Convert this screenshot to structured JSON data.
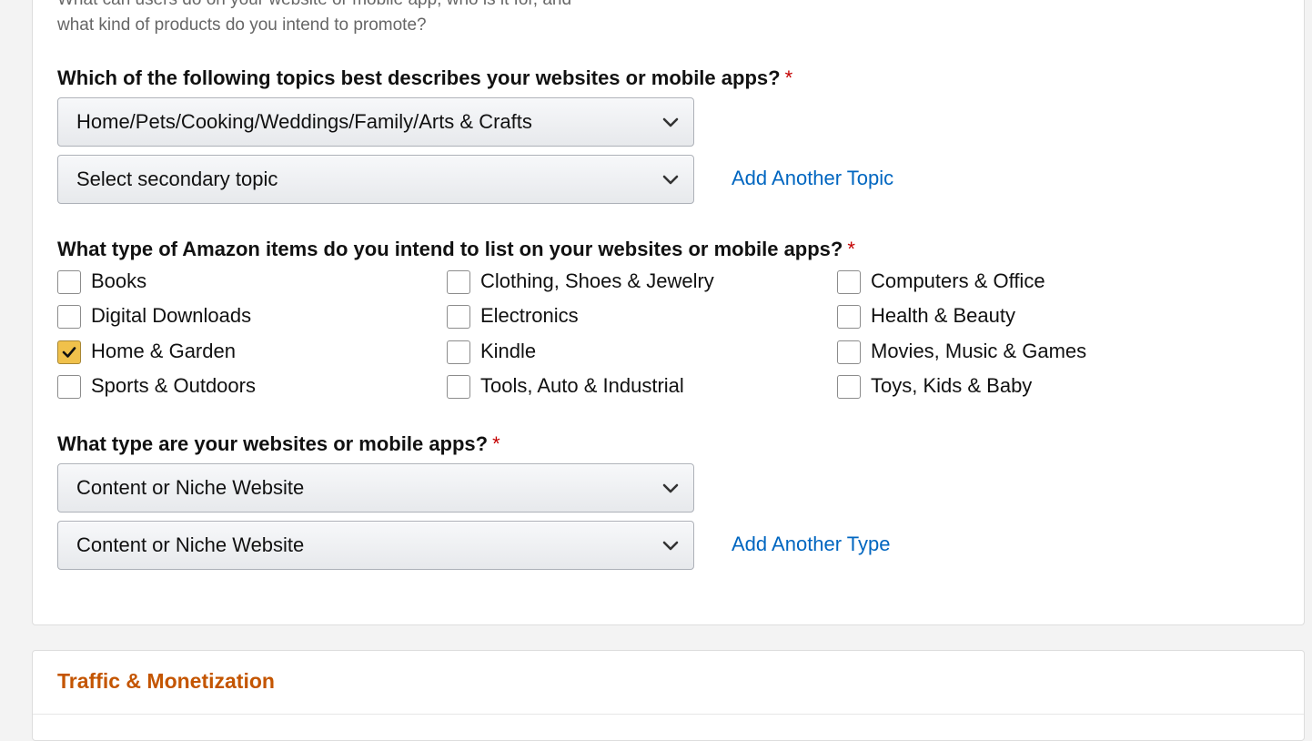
{
  "profile": {
    "helper_line1": "What can users do on your website or mobile app, who is it for, and",
    "helper_line2": "what kind of products do you intend to promote?",
    "topics": {
      "question": "Which of the following topics best describes your websites or mobile apps?",
      "required_mark": "*",
      "primary_value": "Home/Pets/Cooking/Weddings/Family/Arts & Crafts",
      "secondary_value": "Select secondary topic",
      "add_link": "Add Another Topic"
    },
    "items": {
      "question": "What type of Amazon items do you intend to list on your websites or mobile apps?",
      "required_mark": "*",
      "options": [
        {
          "label": "Books",
          "checked": false
        },
        {
          "label": "Clothing, Shoes & Jewelry",
          "checked": false
        },
        {
          "label": "Computers & Office",
          "checked": false
        },
        {
          "label": "Digital Downloads",
          "checked": false
        },
        {
          "label": "Electronics",
          "checked": false
        },
        {
          "label": "Health & Beauty",
          "checked": false
        },
        {
          "label": "Home & Garden",
          "checked": true
        },
        {
          "label": "Kindle",
          "checked": false
        },
        {
          "label": "Movies, Music & Games",
          "checked": false
        },
        {
          "label": "Sports & Outdoors",
          "checked": false
        },
        {
          "label": "Tools, Auto & Industrial",
          "checked": false
        },
        {
          "label": "Toys, Kids & Baby",
          "checked": false
        }
      ]
    },
    "site_type": {
      "question": "What type are your websites or mobile apps?",
      "required_mark": "*",
      "primary_value": "Content or Niche Website",
      "secondary_value": "Content or Niche Website",
      "add_link": "Add Another Type"
    }
  },
  "traffic": {
    "title": "Traffic & Monetization"
  },
  "colors": {
    "link": "#0066c0",
    "required": "#c40000",
    "section_title": "#c45500",
    "checkbox_checked": "#f0c14b"
  },
  "icons": {
    "dropdown": "chevron-down-icon",
    "checkmark": "checkmark-icon"
  }
}
